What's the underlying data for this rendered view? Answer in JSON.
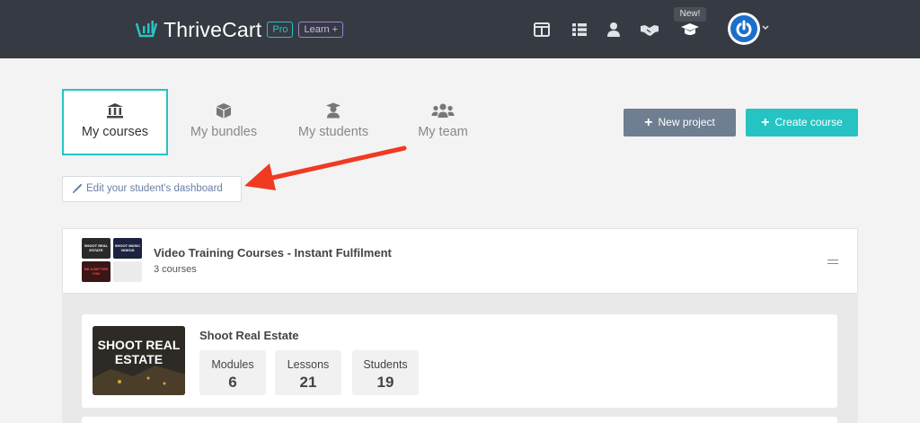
{
  "header": {
    "brand": "ThriveCart",
    "pro_badge": "Pro",
    "learn_badge": "Learn +",
    "new_badge": "New!",
    "brand_color": "#25c4c3",
    "nav_icons": [
      "layout-icon",
      "table-icon",
      "user-icon",
      "handshake-icon",
      "graduation-cap-icon"
    ]
  },
  "tabs": [
    {
      "label": "My courses",
      "icon": "bank-icon",
      "active": true
    },
    {
      "label": "My bundles",
      "icon": "box-icon",
      "active": false
    },
    {
      "label": "My students",
      "icon": "student-icon",
      "active": false
    },
    {
      "label": "My team",
      "icon": "users-icon",
      "active": false
    }
  ],
  "actions": {
    "new_project": "New project",
    "create_course": "Create course",
    "new_project_color": "#6f7e91",
    "create_course_color": "#25c4c3"
  },
  "edit_link": "Edit your student's dashboard",
  "collection": {
    "title": "Video Training Courses - Instant Fulfilment",
    "subtitle": "3 courses",
    "thumbnails": [
      "SHOOT REAL ESTATE",
      "SHOOT MUSIC VIDEOS",
      "BE A BETTER YOU",
      ""
    ]
  },
  "course": {
    "title": "Shoot Real Estate",
    "image_text": "SHOOT REAL ESTATE",
    "stats": [
      {
        "label": "Modules",
        "value": "6"
      },
      {
        "label": "Lessons",
        "value": "21"
      },
      {
        "label": "Students",
        "value": "19"
      }
    ]
  },
  "annotation_color": "#f03a22"
}
